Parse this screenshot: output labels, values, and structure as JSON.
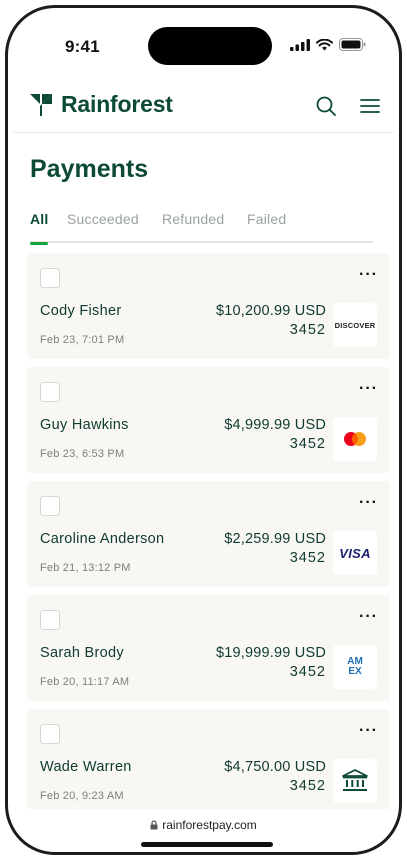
{
  "status": {
    "time": "9:41"
  },
  "header": {
    "brand": "Rainforest"
  },
  "page": {
    "title": "Payments"
  },
  "tabs": [
    {
      "label": "All",
      "active": true
    },
    {
      "label": "Succeeded",
      "active": false
    },
    {
      "label": "Refunded",
      "active": false
    },
    {
      "label": "Failed",
      "active": false
    }
  ],
  "payments": [
    {
      "name": "Cody Fisher",
      "date": "Feb 23, 7:01 PM",
      "amount": "$10,200.99 USD",
      "last4": "3452",
      "card_brand": "DISCOVER"
    },
    {
      "name": "Guy Hawkins",
      "date": "Feb 23, 6:53 PM",
      "amount": "$4,999.99 USD",
      "last4": "3452",
      "card_brand": "mastercard"
    },
    {
      "name": "Caroline Anderson",
      "date": "Feb 21, 13:12 PM",
      "amount": "$2,259.99 USD",
      "last4": "3452",
      "card_brand": "VISA"
    },
    {
      "name": "Sarah Brody",
      "date": "Feb 20, 11:17 AM",
      "amount": "$19,999.99 USD",
      "last4": "3452",
      "card_brand": "AMEX"
    },
    {
      "name": "Wade Warren",
      "date": "Feb 20, 9:23 AM",
      "amount": "$4,750.00 USD",
      "last4": "3452",
      "card_brand": "bank"
    }
  ],
  "more_glyph": "···",
  "browser": {
    "url": "rainforestpay.com"
  },
  "colors": {
    "brand_green": "#0d4a36",
    "accent_green": "#19a33b",
    "card_bg": "#f8f7f4"
  }
}
